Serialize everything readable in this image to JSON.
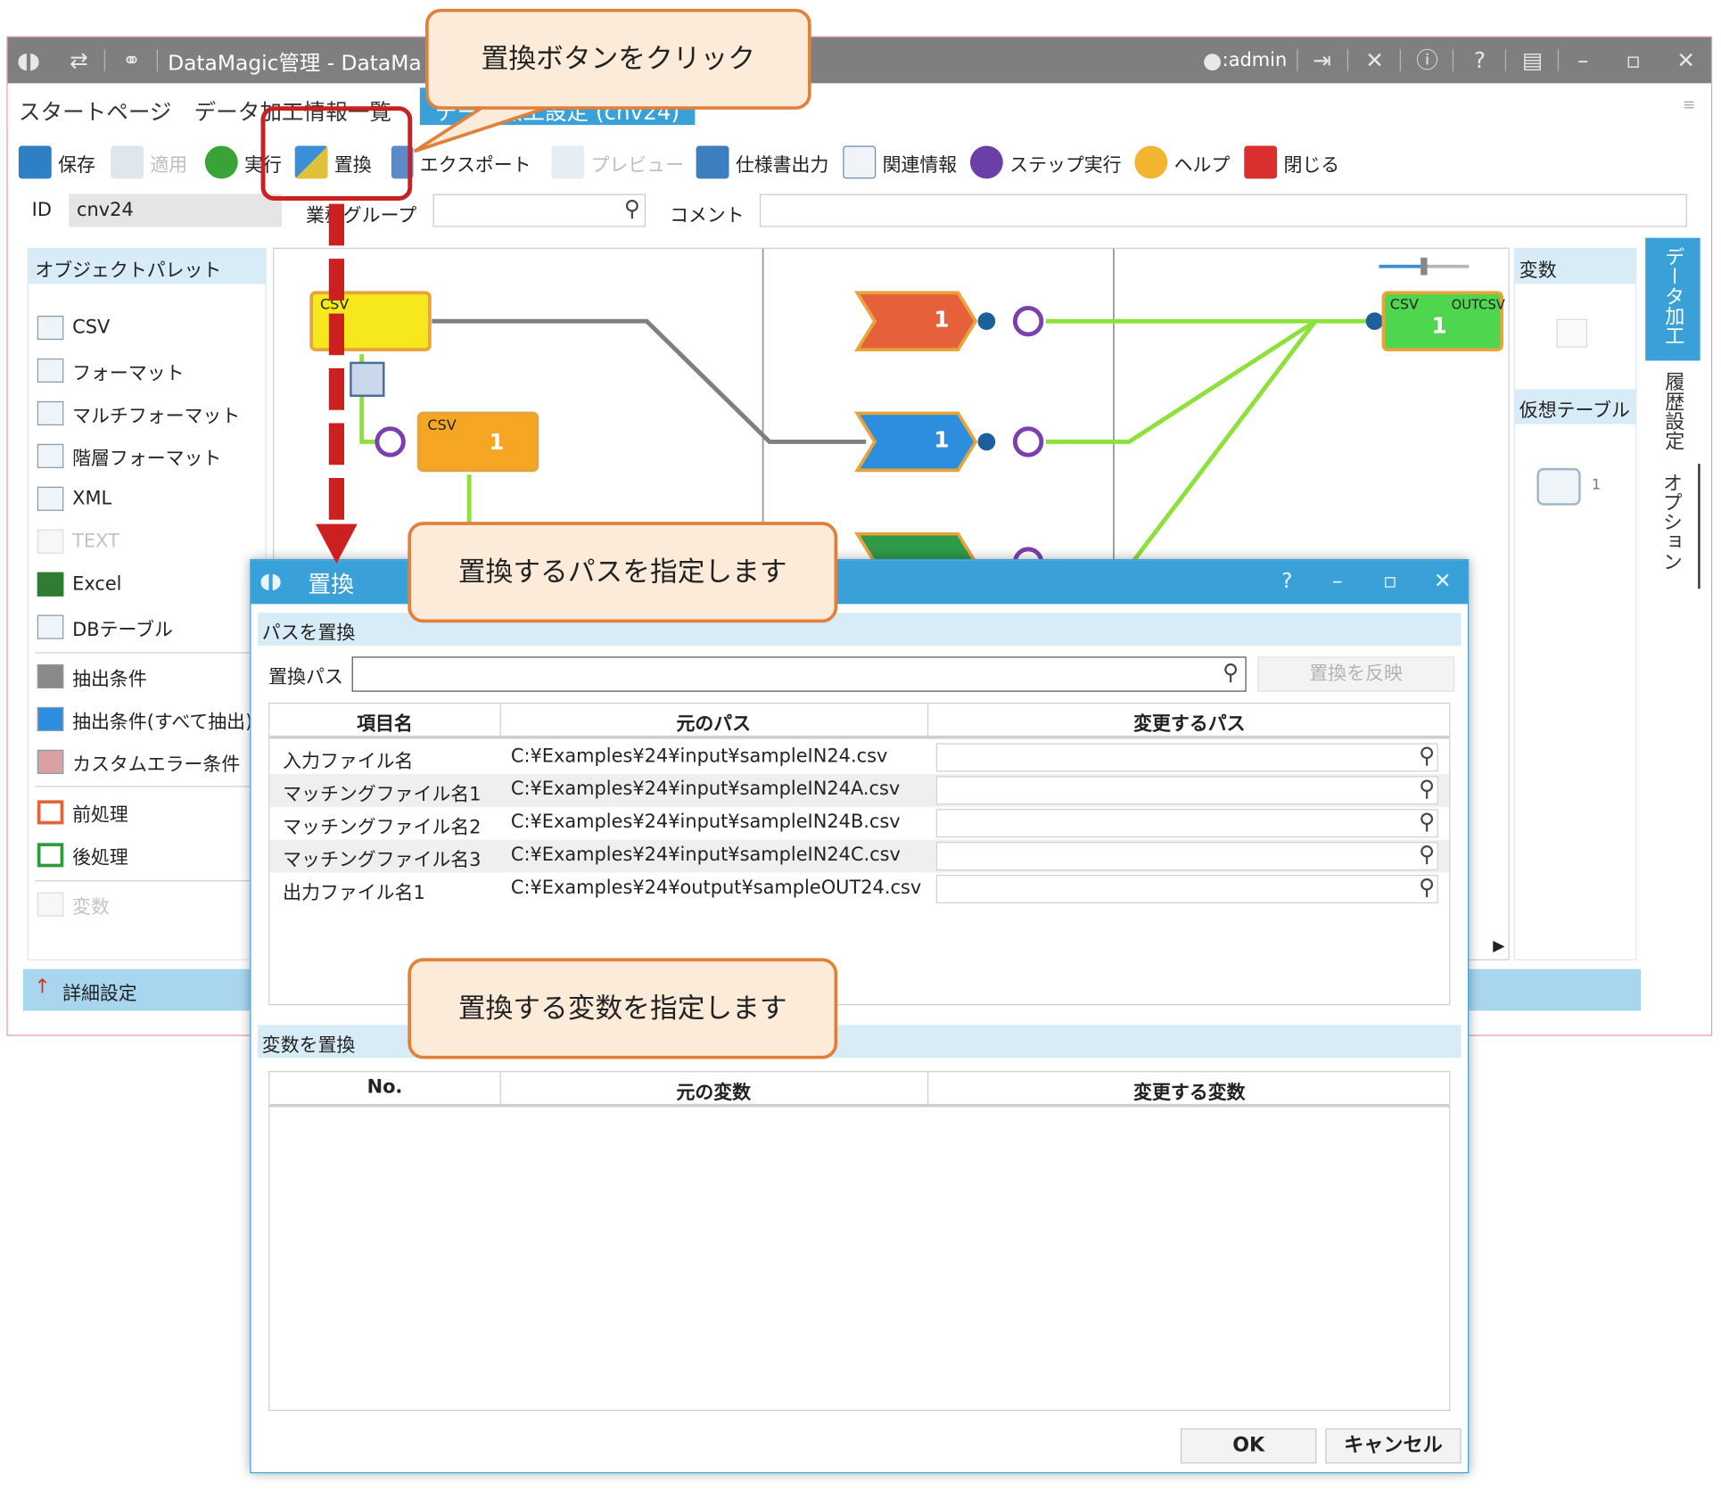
{
  "app": {
    "title": "DataMagic管理 - DataMa",
    "user": ":admin"
  },
  "tabs": [
    {
      "label": "スタートページ"
    },
    {
      "label": "データ加工情報一覧"
    },
    {
      "label": "データ加工設定 (cnv24)"
    }
  ],
  "toolbar": {
    "save": "保存",
    "apply": "適用",
    "run": "実行",
    "replace": "置換",
    "export": "エクスポート",
    "preview": "プレビュー",
    "spec": "仕様書出力",
    "related": "関連情報",
    "step": "ステップ実行",
    "help": "ヘルプ",
    "close": "閉じる"
  },
  "idrow": {
    "id_label": "ID",
    "id_value": "cnv24",
    "group_label": "業務グループ",
    "comment_label": "コメント"
  },
  "palette": {
    "title": "オブジェクトパレット",
    "items": [
      {
        "label": "CSV",
        "enabled": true
      },
      {
        "label": "フォーマット",
        "enabled": true
      },
      {
        "label": "マルチフォーマット",
        "enabled": true
      },
      {
        "label": "階層フォーマット",
        "enabled": true
      },
      {
        "label": "XML",
        "enabled": true
      },
      {
        "label": "TEXT",
        "enabled": false
      },
      {
        "label": "Excel",
        "enabled": true
      },
      {
        "label": "DBテーブル",
        "enabled": true
      },
      {
        "label": "抽出条件",
        "enabled": true
      },
      {
        "label": "抽出条件(すべて抽出)",
        "enabled": true
      },
      {
        "label": "カスタムエラー条件",
        "enabled": true
      },
      {
        "label": "前処理",
        "enabled": true
      },
      {
        "label": "後処理",
        "enabled": true
      },
      {
        "label": "変数",
        "enabled": false
      }
    ],
    "detail": "詳細設定"
  },
  "canvas": {
    "csv_label": "CSV",
    "outcsv_label": "OUTCSV",
    "count": "1"
  },
  "rightpanel": {
    "variables": "変数",
    "virtual_table": "仮想テーブル",
    "vt_count": "1"
  },
  "sidetabs": [
    "データ加工",
    "履歴設定",
    "オプション"
  ],
  "dialog": {
    "title": "置換",
    "path_section": "パスを置換",
    "path_label": "置換パス",
    "apply_button": "置換を反映",
    "path_columns": [
      "項目名",
      "元のパス",
      "変更するパス"
    ],
    "path_rows": [
      {
        "name": "入力ファイル名",
        "path": "C:¥Examples¥24¥input¥sampleIN24.csv"
      },
      {
        "name": "マッチングファイル名1",
        "path": "C:¥Examples¥24¥input¥sampleIN24A.csv"
      },
      {
        "name": "マッチングファイル名2",
        "path": "C:¥Examples¥24¥input¥sampleIN24B.csv"
      },
      {
        "name": "マッチングファイル名3",
        "path": "C:¥Examples¥24¥input¥sampleIN24C.csv"
      },
      {
        "name": "出力ファイル名1",
        "path": "C:¥Examples¥24¥output¥sampleOUT24.csv"
      }
    ],
    "var_section": "変数を置換",
    "var_columns": [
      "No.",
      "元の変数",
      "変更する変数"
    ],
    "ok": "OK",
    "cancel": "キャンセル"
  },
  "callouts": {
    "click_replace": "置換ボタンをクリック",
    "specify_path": "置換するパスを指定します",
    "specify_var": "置換する変数を指定します"
  },
  "colors": {
    "accent": "#3aa0d8",
    "callout_border": "#e0803a",
    "callout_fill": "#fdebd9",
    "highlight_red": "#cc1f1f"
  }
}
